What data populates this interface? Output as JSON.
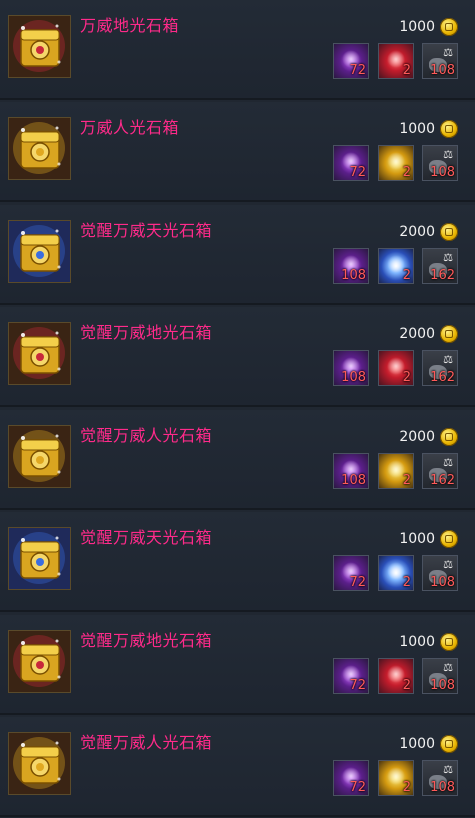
{
  "items": [
    {
      "name": "万威地光石箱",
      "box": "gold-red",
      "price": "1000",
      "mat1_qty": "72",
      "mat2": "red",
      "mat2_qty": "2",
      "mat3_qty": "108"
    },
    {
      "name": "万威人光石箱",
      "box": "gold",
      "price": "1000",
      "mat1_qty": "72",
      "mat2": "gold",
      "mat2_qty": "2",
      "mat3_qty": "108"
    },
    {
      "name": "觉醒万威天光石箱",
      "box": "gold-blue",
      "price": "2000",
      "mat1_qty": "108",
      "mat2": "blue",
      "mat2_qty": "2",
      "mat3_qty": "162"
    },
    {
      "name": "觉醒万威地光石箱",
      "box": "gold-red",
      "price": "2000",
      "mat1_qty": "108",
      "mat2": "red",
      "mat2_qty": "2",
      "mat3_qty": "162"
    },
    {
      "name": "觉醒万威人光石箱",
      "box": "gold",
      "price": "2000",
      "mat1_qty": "108",
      "mat2": "gold",
      "mat2_qty": "2",
      "mat3_qty": "162"
    },
    {
      "name": "觉醒万威天光石箱",
      "box": "gold-blue",
      "price": "1000",
      "mat1_qty": "72",
      "mat2": "blue",
      "mat2_qty": "2",
      "mat3_qty": "108"
    },
    {
      "name": "觉醒万威地光石箱",
      "box": "gold-red",
      "price": "1000",
      "mat1_qty": "72",
      "mat2": "red",
      "mat2_qty": "2",
      "mat3_qty": "108"
    },
    {
      "name": "觉醒万威人光石箱",
      "box": "gold",
      "price": "1000",
      "mat1_qty": "72",
      "mat2": "gold",
      "mat2_qty": "2",
      "mat3_qty": "108"
    }
  ],
  "material_icons": [
    "purple-crystal-icon",
    "gem-orb-icon",
    "ore-scale-icon"
  ],
  "currency_icon": "gold-coin-icon",
  "colors": {
    "item_name": "#ff2a8a",
    "price": "#f2f2f2",
    "quantity": "#ff5a5a",
    "background": "#202731"
  }
}
